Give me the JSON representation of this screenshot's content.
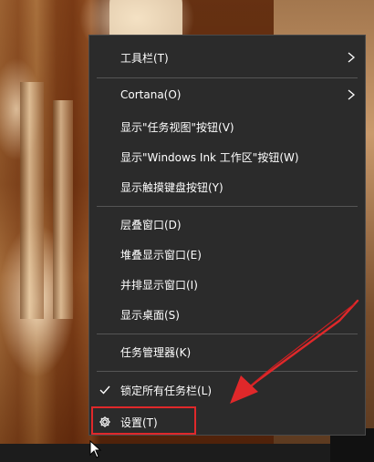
{
  "context_menu": {
    "items": [
      {
        "label": "工具栏(T)",
        "has_submenu": true
      },
      {
        "label": "Cortana(O)",
        "has_submenu": true
      },
      {
        "label": "显示\"任务视图\"按钮(V)"
      },
      {
        "label": "显示\"Windows Ink 工作区\"按钮(W)"
      },
      {
        "label": "显示触摸键盘按钮(Y)"
      },
      {
        "label": "层叠窗口(D)"
      },
      {
        "label": "堆叠显示窗口(E)"
      },
      {
        "label": "并排显示窗口(I)"
      },
      {
        "label": "显示桌面(S)"
      },
      {
        "label": "任务管理器(K)"
      },
      {
        "label": "锁定所有任务栏(L)",
        "checked": true
      },
      {
        "label": "设置(T)",
        "icon": "gear-icon",
        "highlighted": true
      }
    ],
    "colors": {
      "background": "#2b2b2b",
      "text": "#ffffff",
      "separator": "#555555"
    }
  },
  "annotation": {
    "color": "#e0282a",
    "target": "设置(T)"
  }
}
